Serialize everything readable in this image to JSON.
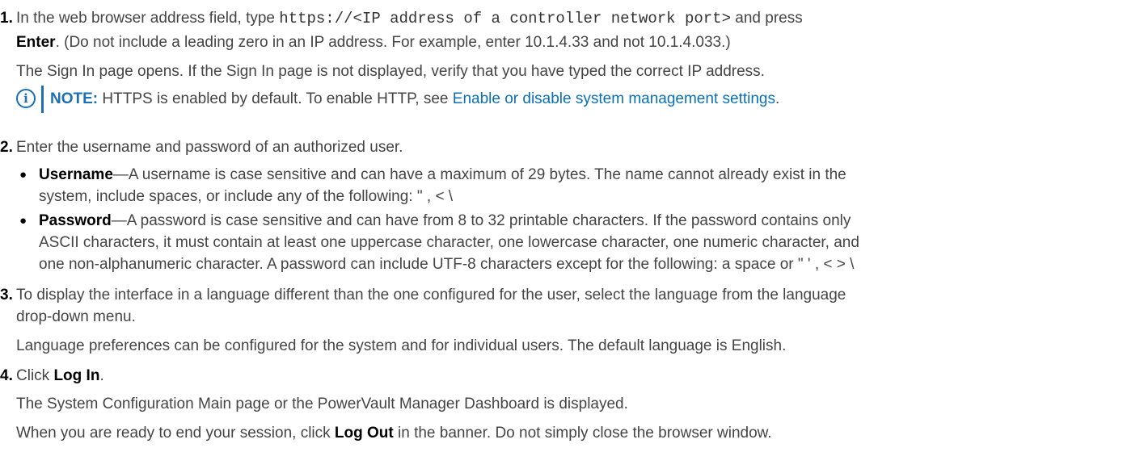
{
  "steps": [
    {
      "number": "1.",
      "line1_a": "In the web browser address field, type ",
      "line1_code": "https://<IP address of a controller network port>",
      "line1_b": " and press",
      "line2_bold": "Enter",
      "line2_rest": ". (Do not include a leading zero in an IP address. For example, enter 10.1.4.33 and not 10.1.4.033.)",
      "result": "The Sign In page opens. If the Sign In page is not displayed, verify that you have typed the correct IP address.",
      "note_label": "NOTE:",
      "note_text": " HTTPS is enabled by default. To enable HTTP, see ",
      "note_link": "Enable or disable system management settings",
      "note_end": "."
    },
    {
      "number": "2.",
      "text": "Enter the username and password of an authorized user.",
      "bullets": [
        {
          "term": "Username",
          "line1": "—A username is case sensitive and can have a maximum of 29 bytes. The name cannot already exist in the",
          "line2": "system, include spaces, or include any of the following: \" , < \\"
        },
        {
          "term": "Password",
          "line1": "—A password is case sensitive and can have from 8 to 32 printable characters. If the password contains only",
          "line2": "ASCII characters, it must contain at least one uppercase character, one lowercase character, one numeric character, and",
          "line3": "one non-alphanumeric character. A password can include UTF-8 characters except for the following: a space or \" ' , < > \\"
        }
      ]
    },
    {
      "number": "3.",
      "line1": "To display the interface in a language different than the one configured for the user, select the language from the language",
      "line2": "drop-down menu.",
      "result": "Language preferences can be configured for the system and for individual users. The default language is English."
    },
    {
      "number": "4.",
      "text_a": "Click ",
      "text_bold": "Log In",
      "text_b": ".",
      "result1": "The System Configuration Main page or the PowerVault Manager Dashboard is displayed.",
      "result2_a": "When you are ready to end your session, click ",
      "result2_bold": "Log Out",
      "result2_b": " in the banner. Do not simply close the browser window."
    }
  ]
}
